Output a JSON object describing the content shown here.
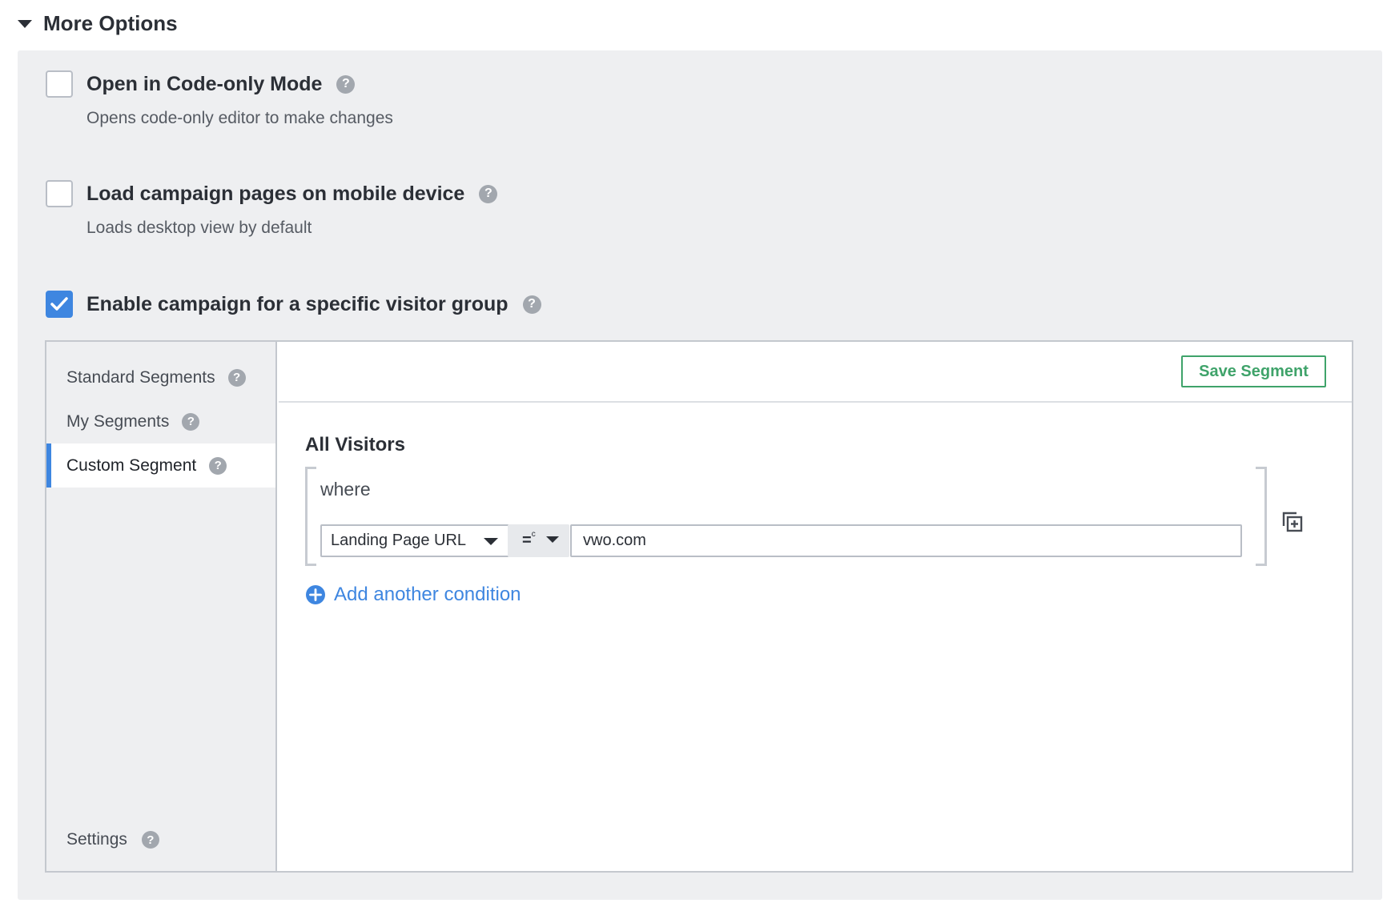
{
  "header": {
    "title": "More Options"
  },
  "options": [
    {
      "label": "Open in Code-only Mode",
      "description": "Opens code-only editor to make changes",
      "checked": false
    },
    {
      "label": "Load campaign pages on mobile device",
      "description": "Loads desktop view by default",
      "checked": false
    },
    {
      "label": "Enable campaign for a specific visitor group",
      "checked": true
    }
  ],
  "help_glyph": "?",
  "segments": {
    "sidebar": {
      "items": [
        {
          "label": "Standard Segments"
        },
        {
          "label": "My Segments"
        },
        {
          "label": "Custom Segment",
          "active": true
        }
      ],
      "settings_label": "Settings"
    },
    "save_label": "Save Segment",
    "group_title": "All Visitors",
    "where_label": "where",
    "condition": {
      "attribute": "Landing Page URL",
      "operator": "=",
      "operator_sup": "c",
      "value": "vwo.com"
    },
    "add_condition_label": "Add another condition"
  },
  "colors": {
    "accent": "#3e86e0",
    "save_green": "#3fa36a",
    "panel_bg": "#eeeff1",
    "help_gray": "#a2a7ae"
  },
  "icons": [
    "caret-down-icon",
    "help-icon",
    "check-icon",
    "copy-add-icon",
    "plus-circle-icon"
  ]
}
